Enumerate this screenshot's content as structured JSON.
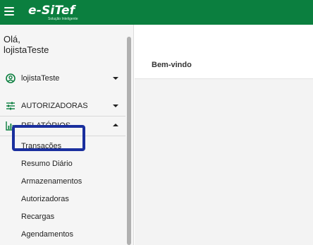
{
  "header": {
    "logo_text": "e-SiTef",
    "logo_tagline": "Solução Inteligente"
  },
  "sidebar": {
    "greeting": "Olá,",
    "username": "lojistaTeste",
    "items": [
      {
        "label": "lojistaTeste",
        "icon": "user-circle-icon"
      },
      {
        "label": "AUTORIZADORAS",
        "icon": "sliders-icon"
      },
      {
        "label": "RELATÓRIOS",
        "icon": "bar-chart-icon"
      }
    ],
    "sub_items": [
      "Transações",
      "Resumo Diário",
      "Armazenamentos",
      "Autorizadoras",
      "Recargas",
      "Agendamentos"
    ]
  },
  "main": {
    "title": "Bem-vindo"
  },
  "colors": {
    "brand_green": "#0b7f3f",
    "highlight_border": "#1a2f9e"
  }
}
